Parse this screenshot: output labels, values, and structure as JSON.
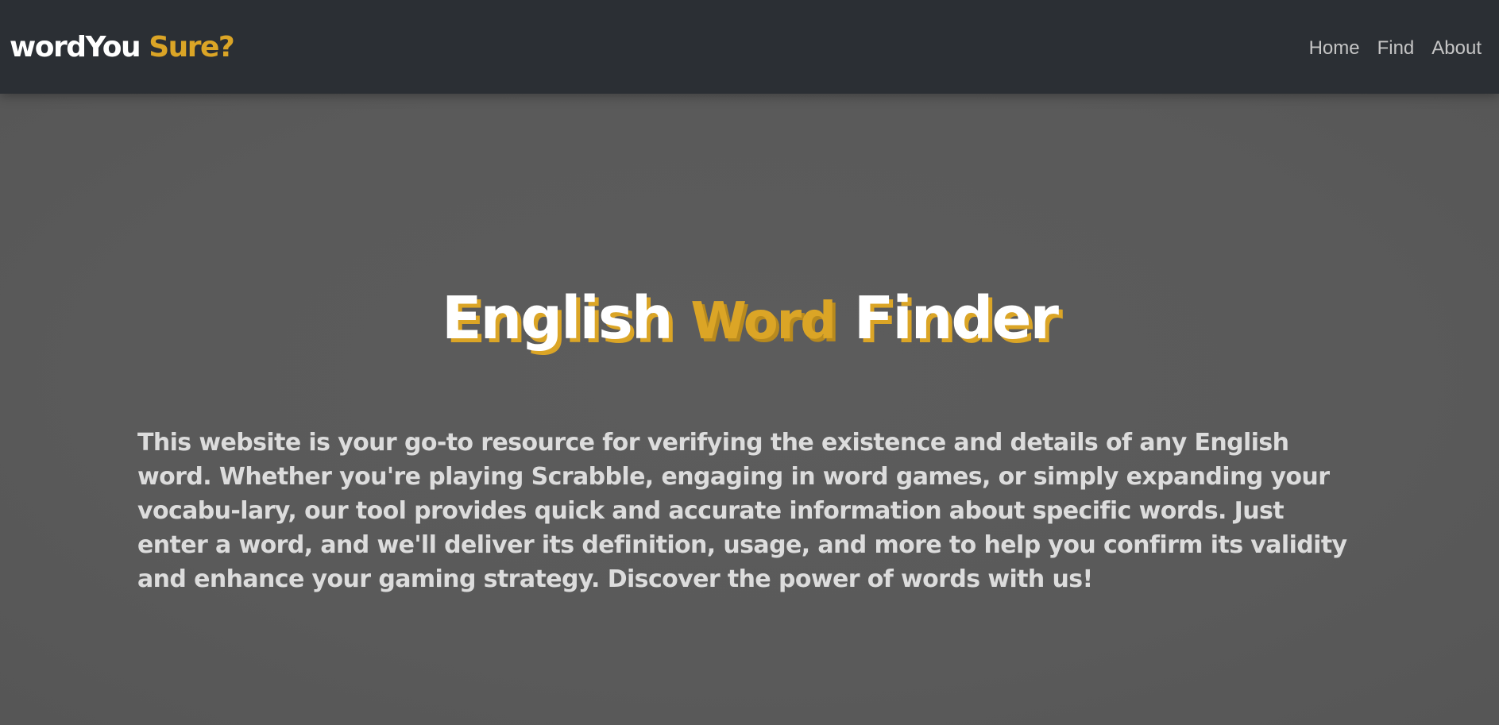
{
  "navbar": {
    "brand": {
      "part1": "wordYou",
      "part2": "Sure?"
    },
    "links": [
      {
        "label": "Home"
      },
      {
        "label": "Find"
      },
      {
        "label": "About"
      }
    ]
  },
  "hero": {
    "title_part1": "English",
    "title_accent": "Word",
    "title_part2": "Finder",
    "description": "This website is your go-to resource for verifying the existence and details of any English word. Whether you're playing Scrabble, engaging in word games, or simply expanding your vocabu-lary, our tool provides quick and accurate information about specific words. Just enter a word, and we'll deliver its definition, usage, and more to help you confirm its validity and enhance your gaming strategy. Discover the power of words with us!"
  },
  "colors": {
    "navbar_bg": "#2b2f34",
    "page_bg": "#595959",
    "accent": "#dba526",
    "title_text": "#ffffff",
    "body_text": "#dcdcdc",
    "nav_link": "#c5c5c5"
  }
}
